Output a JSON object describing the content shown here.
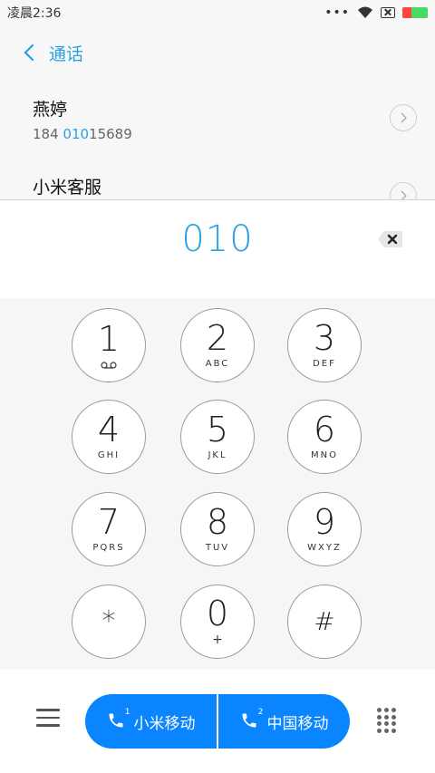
{
  "status": {
    "time": "凌晨2:36",
    "dots": "•••"
  },
  "header": {
    "title": "通话"
  },
  "contacts": [
    {
      "name": "燕婷",
      "number_pre": "184 ",
      "number_hl": "010",
      "number_post": "15689"
    },
    {
      "name": "小米客服",
      "number_pre": "",
      "number_hl": "",
      "number_post": ""
    }
  ],
  "input": {
    "value": "010"
  },
  "keypad": [
    {
      "digit": "1",
      "letters": ""
    },
    {
      "digit": "2",
      "letters": "ABC"
    },
    {
      "digit": "3",
      "letters": "DEF"
    },
    {
      "digit": "4",
      "letters": "GHI"
    },
    {
      "digit": "5",
      "letters": "JKL"
    },
    {
      "digit": "6",
      "letters": "MNO"
    },
    {
      "digit": "7",
      "letters": "PQRS"
    },
    {
      "digit": "8",
      "letters": "TUV"
    },
    {
      "digit": "9",
      "letters": "WXYZ"
    },
    {
      "digit": "*",
      "letters": ""
    },
    {
      "digit": "0",
      "letters": "+"
    },
    {
      "digit": "#",
      "letters": ""
    }
  ],
  "call": {
    "sim1_label": "小米移动",
    "sim1_index": "1",
    "sim2_label": "中国移动",
    "sim2_index": "2",
    "color": "#0a84ff"
  },
  "icons": [
    "wifi-icon",
    "sim-disabled-icon",
    "battery-icon",
    "back-arrow-icon",
    "chevron-right-icon",
    "backspace-icon",
    "voicemail-icon",
    "menu-icon",
    "phone-icon",
    "dialpad-icon"
  ],
  "colors": {
    "accent": "#2aa0e6"
  }
}
